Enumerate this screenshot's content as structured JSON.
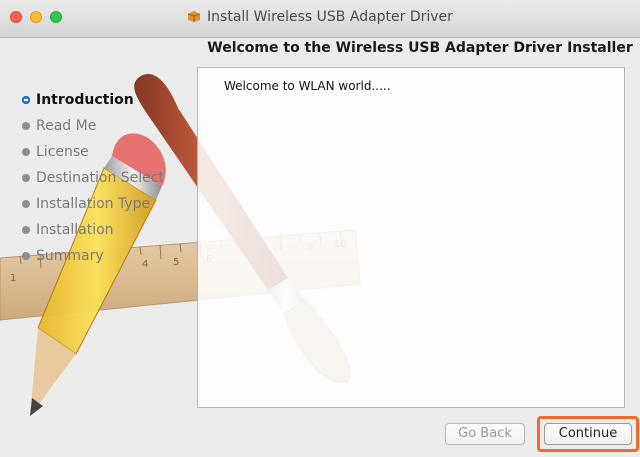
{
  "window": {
    "title": "Install Wireless USB Adapter Driver"
  },
  "header": {
    "title": "Welcome to the Wireless USB Adapter Driver Installer"
  },
  "sidebar": {
    "steps": [
      {
        "label": "Introduction",
        "active": true
      },
      {
        "label": "Read Me",
        "active": false
      },
      {
        "label": "License",
        "active": false
      },
      {
        "label": "Destination Select",
        "active": false
      },
      {
        "label": "Installation Type",
        "active": false
      },
      {
        "label": "Installation",
        "active": false
      },
      {
        "label": "Summary",
        "active": false
      }
    ]
  },
  "content": {
    "message": "Welcome to WLAN world....."
  },
  "buttons": {
    "go_back": "Go Back",
    "continue": "Continue"
  },
  "colors": {
    "active_step": "#2d7be5",
    "highlight": "#ef6d2a"
  },
  "icons": {
    "title_icon": "package-icon"
  },
  "illustration": {
    "ruler_marks": [
      "1",
      "4",
      "5",
      "6",
      "9",
      "10"
    ]
  }
}
